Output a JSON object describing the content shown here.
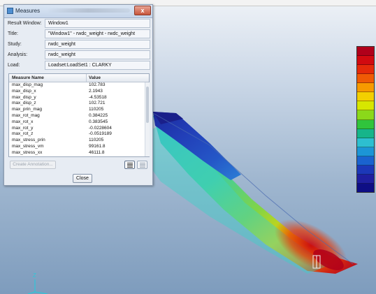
{
  "dialog": {
    "title": "Measures",
    "close_glyph": "x",
    "fields": [
      {
        "label": "Result Window:",
        "value": "Window1"
      },
      {
        "label": "Title:",
        "value": "\"Window1\" - rwdc_weight - rwdc_weight"
      },
      {
        "label": "Study:",
        "value": "rwdc_weight"
      },
      {
        "label": "Analysis:",
        "value": "rwdc_weight"
      },
      {
        "label": "Load:",
        "value": "Loadset:LoadSet1 : CLARKY"
      }
    ],
    "table": {
      "headers": {
        "name": "Measure Name",
        "value": "Value"
      },
      "rows": [
        {
          "name": "max_disp_mag",
          "value": "102.783"
        },
        {
          "name": "max_disp_x",
          "value": "2.1943"
        },
        {
          "name": "max_disp_y",
          "value": "-4.53518"
        },
        {
          "name": "max_disp_z",
          "value": "102.721"
        },
        {
          "name": "max_prin_mag",
          "value": "110205"
        },
        {
          "name": "max_rot_mag",
          "value": "0.384225"
        },
        {
          "name": "max_rot_x",
          "value": "0.383545"
        },
        {
          "name": "max_rot_y",
          "value": "-0.0228604"
        },
        {
          "name": "max_rot_z",
          "value": "-0.0519189"
        },
        {
          "name": "max_stress_prin",
          "value": "110205"
        },
        {
          "name": "max_stress_vm",
          "value": "99161.8"
        },
        {
          "name": "max_stress_xx",
          "value": "46111.8"
        }
      ]
    },
    "create_annotation_label": "Create Annotation...",
    "close_label": "Close"
  },
  "legend": {
    "colors": [
      "#b0001a",
      "#d10a10",
      "#e42a0a",
      "#ef5a05",
      "#f79a00",
      "#f3cf00",
      "#d7e600",
      "#8bd81a",
      "#30c43c",
      "#16b58a",
      "#2dbfd0",
      "#1c95d6",
      "#1a63cf",
      "#1c38b8",
      "#1f1fa0",
      "#0e0e85"
    ]
  },
  "triad": {
    "axis_label": "Z"
  }
}
